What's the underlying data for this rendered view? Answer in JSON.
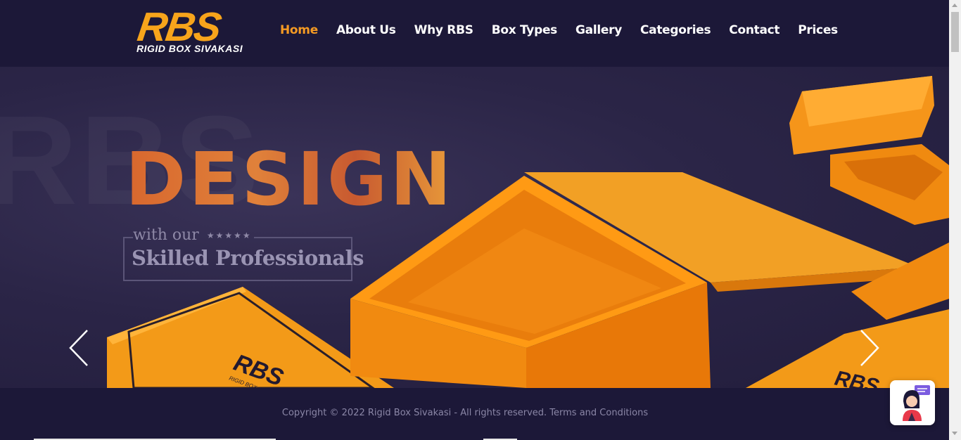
{
  "header": {
    "logo_text": "RBS",
    "logo_subtitle": "RIGID BOX SIVAKASI",
    "nav": [
      {
        "label": "Home",
        "active": true
      },
      {
        "label": "About Us"
      },
      {
        "label": "Why RBS"
      },
      {
        "label": "Box Types"
      },
      {
        "label": "Gallery"
      },
      {
        "label": "Categories"
      },
      {
        "label": "Contact"
      },
      {
        "label": "Prices"
      }
    ]
  },
  "hero": {
    "title": "DESIGN",
    "with_text": "with our",
    "stars": "★★★★★",
    "subtitle": "Skilled Professionals",
    "box_brand": "RBS",
    "box_brand_sub": "RIGID BOX SIVAKASI",
    "colors": {
      "accent": "#f7a41b",
      "box": "#f08a12",
      "background": "#2a2546"
    }
  },
  "footer": {
    "copyright": "Copyright © 2022 Rigid Box Sivakasi - All rights reserved.",
    "terms_link": "Terms and Conditions"
  },
  "icons": {
    "prev": "chevron-left-icon",
    "next": "chevron-right-icon",
    "chat": "chat-agent-icon"
  }
}
